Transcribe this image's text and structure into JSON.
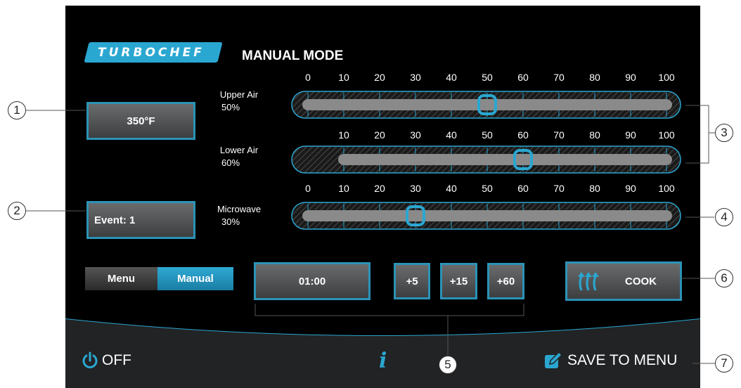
{
  "brand": {
    "logo_text": "TURBOCHEF",
    "accent_color": "#2aa7d1"
  },
  "header": {
    "title": "MANUAL MODE"
  },
  "temperature": {
    "label": "350°F"
  },
  "event": {
    "label": "Event: 1"
  },
  "mode_toggle": {
    "menu_label": "Menu",
    "manual_label": "Manual",
    "selected": "Manual"
  },
  "sliders": [
    {
      "name": "Upper Air",
      "value_label": "50%",
      "value": 50,
      "min": 0,
      "max": 100,
      "ticks": [
        "0",
        "10",
        "20",
        "30",
        "40",
        "50",
        "60",
        "70",
        "80",
        "90",
        "100"
      ]
    },
    {
      "name": "Lower Air",
      "value_label": "60%",
      "value": 60,
      "min": 10,
      "max": 100,
      "ticks": [
        "10",
        "20",
        "30",
        "40",
        "50",
        "60",
        "70",
        "80",
        "90",
        "100"
      ]
    },
    {
      "name": "Microwave",
      "value_label": "30%",
      "value": 30,
      "min": 0,
      "max": 100,
      "ticks": [
        "0",
        "10",
        "20",
        "30",
        "40",
        "50",
        "60",
        "70",
        "80",
        "90",
        "100"
      ]
    }
  ],
  "timer": {
    "value": "01:00"
  },
  "time_add": {
    "plus5": "+5",
    "plus15": "+15",
    "plus60": "+60"
  },
  "cook": {
    "label": "COOK",
    "icon": "heat-arrows-icon"
  },
  "footer": {
    "off_label": "OFF",
    "save_label": "SAVE TO MENU",
    "info_glyph": "i",
    "off_icon": "power-icon",
    "save_icon": "edit-icon"
  },
  "callouts": [
    "1",
    "2",
    "3",
    "4",
    "5",
    "6",
    "7"
  ]
}
